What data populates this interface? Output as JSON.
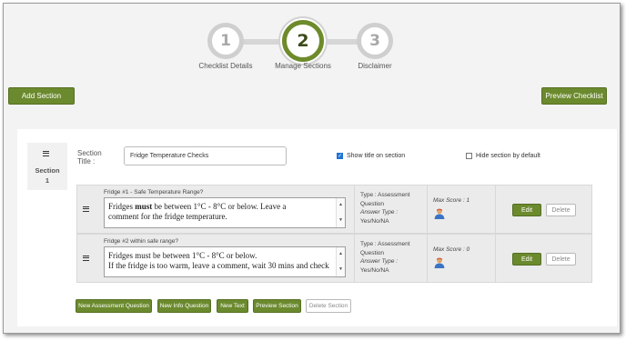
{
  "stepper": {
    "steps": [
      {
        "number": "1",
        "label": "Checklist Details"
      },
      {
        "number": "2",
        "label": "Manage Sections"
      },
      {
        "number": "3",
        "label": "Disclaimer"
      }
    ],
    "active_step": 2
  },
  "toolbar": {
    "add_section": "Add Section",
    "preview_checklist": "Preview Checklist"
  },
  "section": {
    "side_label_line1": "Section",
    "side_label_line2": "1",
    "title_label_line1": "Section",
    "title_label_line2": "Title :",
    "title_value": "Fridge Temperature Checks",
    "show_title": {
      "label": "Show title on section",
      "checked": true
    },
    "hide_by_default": {
      "label": "Hide section by default",
      "checked": false
    }
  },
  "questions": [
    {
      "title": "Fridge #1 - Safe Temperature Range?",
      "text_pre": "Fridges ",
      "text_bold": "must",
      "text_post": " be between 1°C - 8°C or below. Leave a",
      "text_line2": "comment for the fridge temperature.",
      "type_label": "Type : Assessment",
      "type_label2": "Question",
      "answer_type_label": "Answer Type :",
      "answer_type_value": "Yes/No/NA",
      "max_score_label": "Max Score : 1",
      "edit": "Edit",
      "delete": "Delete"
    },
    {
      "title": "Fridge #2 within safe range?",
      "text_line1": "Fridges must be between 1°C - 8°C or below.",
      "text_line2": "If the fridge is too warm, leave a comment, wait 30 mins and check",
      "type_label": "Type : Assessment",
      "type_label2": "Question",
      "answer_type_label": "Answer Type :",
      "answer_type_value": "Yes/No/NA",
      "max_score_label": "Max Score : 0",
      "edit": "Edit",
      "delete": "Delete"
    }
  ],
  "actions": {
    "new_assessment": "New Assessment Question",
    "new_info": "New Info Question",
    "new_text": "New Text",
    "preview_section": "Preview Section",
    "delete_section": "Delete Section"
  },
  "colors": {
    "accent_green": "#6b8a2e",
    "checkbox_blue": "#1f73d6"
  },
  "icons": [
    "drag-handle-icon",
    "person-score-icon",
    "checkmark-icon",
    "scroll-up-arrow-icon",
    "scroll-down-arrow-icon"
  ]
}
